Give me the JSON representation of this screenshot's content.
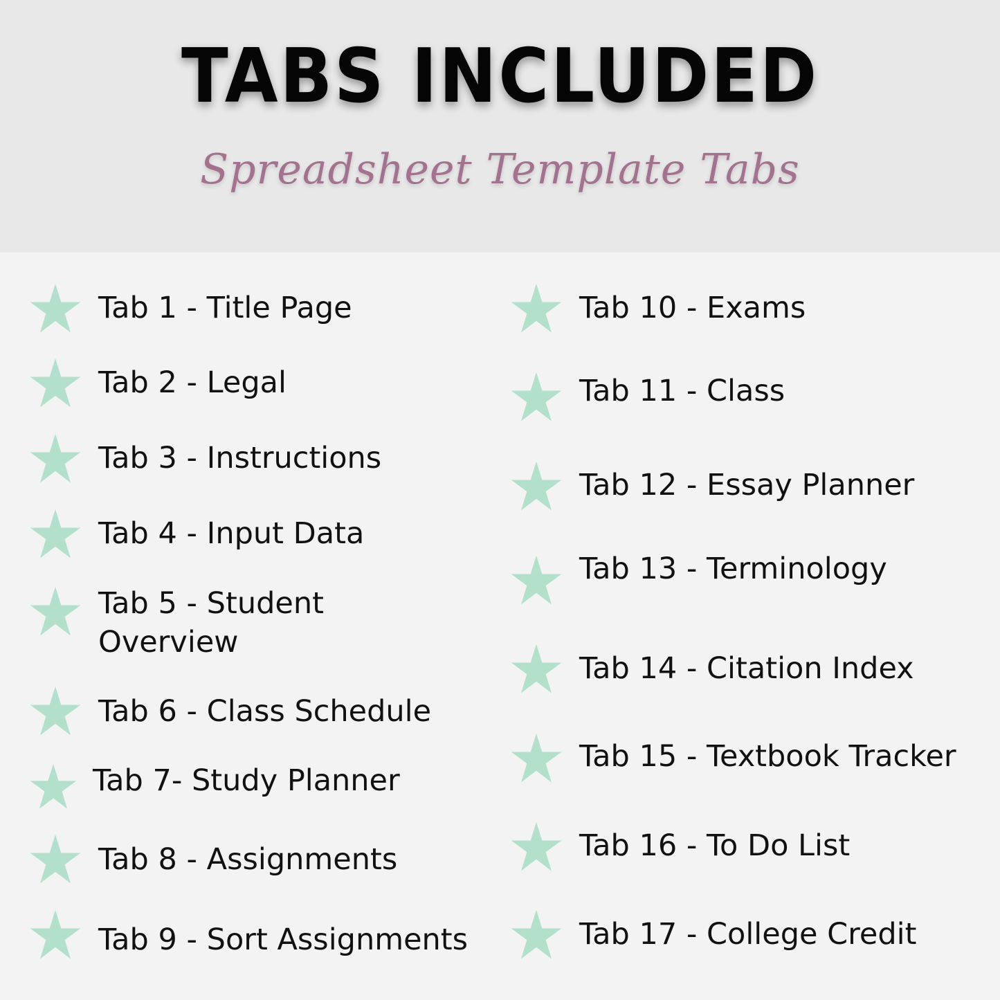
{
  "header": {
    "title": "TABS INCLUDED",
    "subtitle": "Spreadsheet Template Tabs"
  },
  "colors": {
    "star": "#b2e0cb",
    "subtitle": "#a2728f",
    "header_bg": "#e8e8e8",
    "body_bg": "#f3f3f3"
  },
  "icon": "star-icon",
  "left_column": [
    {
      "label": "Tab 1 - Title Page"
    },
    {
      "label": "Tab 2 - Legal"
    },
    {
      "label": "Tab 3 - Instructions"
    },
    {
      "label": "Tab 4 - Input Data"
    },
    {
      "label_line1": "Tab 5 - Student",
      "label_line2": "Overview"
    },
    {
      "label": "Tab 6 - Class Schedule"
    },
    {
      "label": "Tab 7- Study Planner"
    },
    {
      "label": "Tab 8 - Assignments"
    },
    {
      "label": "Tab 9 - Sort Assignments"
    }
  ],
  "right_column": [
    {
      "label": "Tab 10 - Exams"
    },
    {
      "label": "Tab 11 - Class"
    },
    {
      "label": "Tab 12 - Essay Planner"
    },
    {
      "label": "Tab 13 - Terminology"
    },
    {
      "label": "Tab 14 - Citation Index"
    },
    {
      "label": "Tab 15 - Textbook Tracker"
    },
    {
      "label": "Tab 16 - To Do List"
    },
    {
      "label": "Tab 17 - College Credit"
    }
  ]
}
